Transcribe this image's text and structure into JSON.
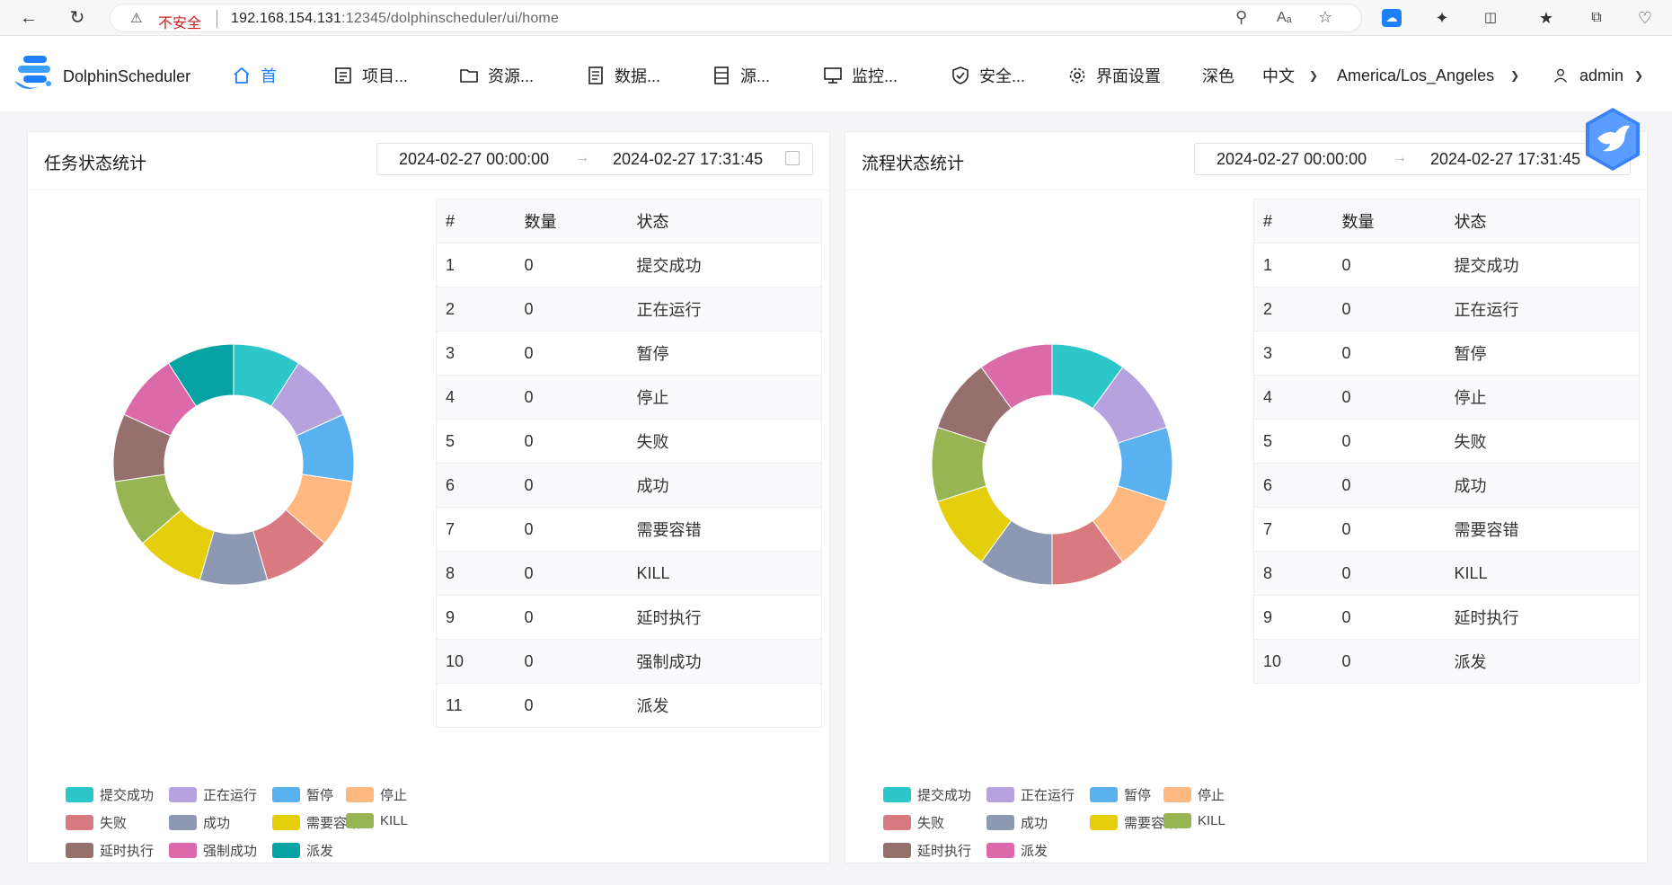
{
  "browser": {
    "insecure_label": "不安全",
    "url_host": "192.168.154.131",
    "url_rest": ":12345/dolphinscheduler/ui/home"
  },
  "header": {
    "logo_text": "DolphinScheduler",
    "nav": [
      {
        "label": "首",
        "icon": "home-icon"
      },
      {
        "label": "项目...",
        "icon": "project-icon"
      },
      {
        "label": "资源...",
        "icon": "folder-icon"
      },
      {
        "label": "数据...",
        "icon": "data-icon"
      },
      {
        "label": "源...",
        "icon": "datasource-icon"
      },
      {
        "label": "监控...",
        "icon": "monitor-icon"
      },
      {
        "label": "安全...",
        "icon": "shield-icon"
      },
      {
        "label": "界面设置",
        "icon": "gear-icon"
      }
    ],
    "theme_label": "深色",
    "language": "中文",
    "timezone": "America/Los_Angeles",
    "user": "admin"
  },
  "colors": {
    "accent": "#1e7fff",
    "segments": [
      "#2ec7c9",
      "#b6a2de",
      "#5ab1ef",
      "#ffb980",
      "#d87a80",
      "#8d98b3",
      "#e5cf0d",
      "#97b552",
      "#95706d",
      "#dc69aa",
      "#07a2a4"
    ]
  },
  "task_panel": {
    "title": "任务状态统计",
    "date_start": "2024-02-27 00:00:00",
    "date_end": "2024-02-27 17:31:45",
    "table_headers": [
      "#",
      "数量",
      "状态"
    ],
    "rows": [
      [
        "1",
        "0",
        "提交成功"
      ],
      [
        "2",
        "0",
        "正在运行"
      ],
      [
        "3",
        "0",
        "暂停"
      ],
      [
        "4",
        "0",
        "停止"
      ],
      [
        "5",
        "0",
        "失败"
      ],
      [
        "6",
        "0",
        "成功"
      ],
      [
        "7",
        "0",
        "需要容错"
      ],
      [
        "8",
        "0",
        "KILL"
      ],
      [
        "9",
        "0",
        "延时执行"
      ],
      [
        "10",
        "0",
        "强制成功"
      ],
      [
        "11",
        "0",
        "派发"
      ]
    ],
    "legend": [
      "提交成功",
      "正在运行",
      "暂停",
      "停止",
      "失败",
      "成功",
      "需要容错",
      "KILL",
      "延时执行",
      "强制成功",
      "派发"
    ]
  },
  "process_panel": {
    "title": "流程状态统计",
    "date_start": "2024-02-27 00:00:00",
    "date_end": "2024-02-27 17:31:45",
    "table_headers": [
      "#",
      "数量",
      "状态"
    ],
    "rows": [
      [
        "1",
        "0",
        "提交成功"
      ],
      [
        "2",
        "0",
        "正在运行"
      ],
      [
        "3",
        "0",
        "暂停"
      ],
      [
        "4",
        "0",
        "停止"
      ],
      [
        "5",
        "0",
        "失败"
      ],
      [
        "6",
        "0",
        "成功"
      ],
      [
        "7",
        "0",
        "需要容错"
      ],
      [
        "8",
        "0",
        "KILL"
      ],
      [
        "9",
        "0",
        "延时执行"
      ],
      [
        "10",
        "0",
        "派发"
      ]
    ],
    "legend": [
      "提交成功",
      "正在运行",
      "暂停",
      "停止",
      "失败",
      "成功",
      "需要容错",
      "KILL",
      "延时执行",
      "派发"
    ]
  }
}
